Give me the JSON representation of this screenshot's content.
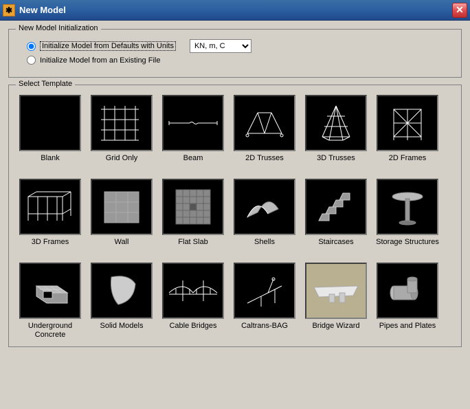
{
  "window": {
    "title": "New Model"
  },
  "initialization": {
    "group_title": "New Model Initialization",
    "radio_defaults": "Initialize Model from Defaults with Units",
    "radio_existing": "Initialize Model  from an Existing File",
    "selected_units": "KN, m, C"
  },
  "templates": {
    "group_title": "Select Template",
    "items": [
      {
        "label": "Blank"
      },
      {
        "label": "Grid Only"
      },
      {
        "label": "Beam"
      },
      {
        "label": "2D Trusses"
      },
      {
        "label": "3D Trusses"
      },
      {
        "label": "2D Frames"
      },
      {
        "label": "3D Frames"
      },
      {
        "label": "Wall"
      },
      {
        "label": "Flat Slab"
      },
      {
        "label": "Shells"
      },
      {
        "label": "Staircases"
      },
      {
        "label": "Storage Structures"
      },
      {
        "label": "Underground Concrete"
      },
      {
        "label": "Solid Models"
      },
      {
        "label": "Cable Bridges"
      },
      {
        "label": "Caltrans-BAG"
      },
      {
        "label": "Bridge Wizard"
      },
      {
        "label": "Pipes and Plates"
      }
    ]
  }
}
